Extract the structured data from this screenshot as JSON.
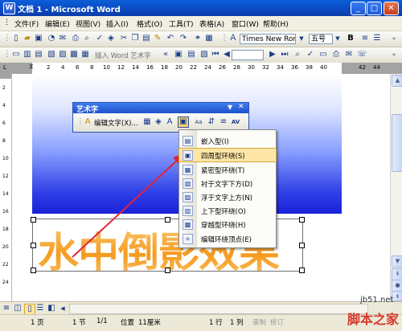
{
  "window": {
    "title": "文档 1 - Microsoft Word",
    "app_icon": "W"
  },
  "menu": [
    "文件(F)",
    "编辑(E)",
    "视图(V)",
    "插入(I)",
    "格式(O)",
    "工具(T)",
    "表格(A)",
    "窗口(W)",
    "帮助(H)"
  ],
  "toolbar": {
    "font": "Times New Roman",
    "size": "五号",
    "bold": "B",
    "wordart_insert": "插入 Word 艺术字"
  },
  "ruler_numbers": [
    "L",
    "2",
    "4",
    "6",
    "8",
    "10",
    "12",
    "14",
    "16",
    "18",
    "20",
    "22",
    "24",
    "26",
    "28",
    "30",
    "32",
    "34",
    "36",
    "38",
    "40",
    "42",
    "44"
  ],
  "vruler_numbers": [
    "2",
    "4",
    "6",
    "8",
    "10",
    "12",
    "14",
    "16",
    "18",
    "20",
    "22",
    "24"
  ],
  "wordart_toolbar": {
    "title": "艺术字",
    "edit_text": "编辑文字(X)...",
    "letter_spacing": "AV"
  },
  "wrap_menu": {
    "items": [
      "嵌入型(I)",
      "四周型环绕(S)",
      "紧密型环绕(T)",
      "衬于文字下方(D)",
      "浮于文字上方(N)",
      "上下型环绕(O)",
      "穿越型环绕(H)",
      "编辑环绕顶点(E)"
    ],
    "highlighted_index": 1
  },
  "wordart_text": "水中倒影效果",
  "status": {
    "page": "1 页",
    "section": "1 节",
    "pages": "1/1",
    "position_label": "位置",
    "position_value": "11厘米",
    "line": "1 行",
    "column": "1 列",
    "rec": "录制",
    "trk": "修订"
  },
  "watermark": {
    "site": "jb51.net",
    "brand": "脚本之家"
  },
  "colors": {
    "title_bar": "#0b49c0",
    "highlight": "#ffe6a7",
    "wordart": "#f5a623",
    "arrow": "#e2233a"
  }
}
